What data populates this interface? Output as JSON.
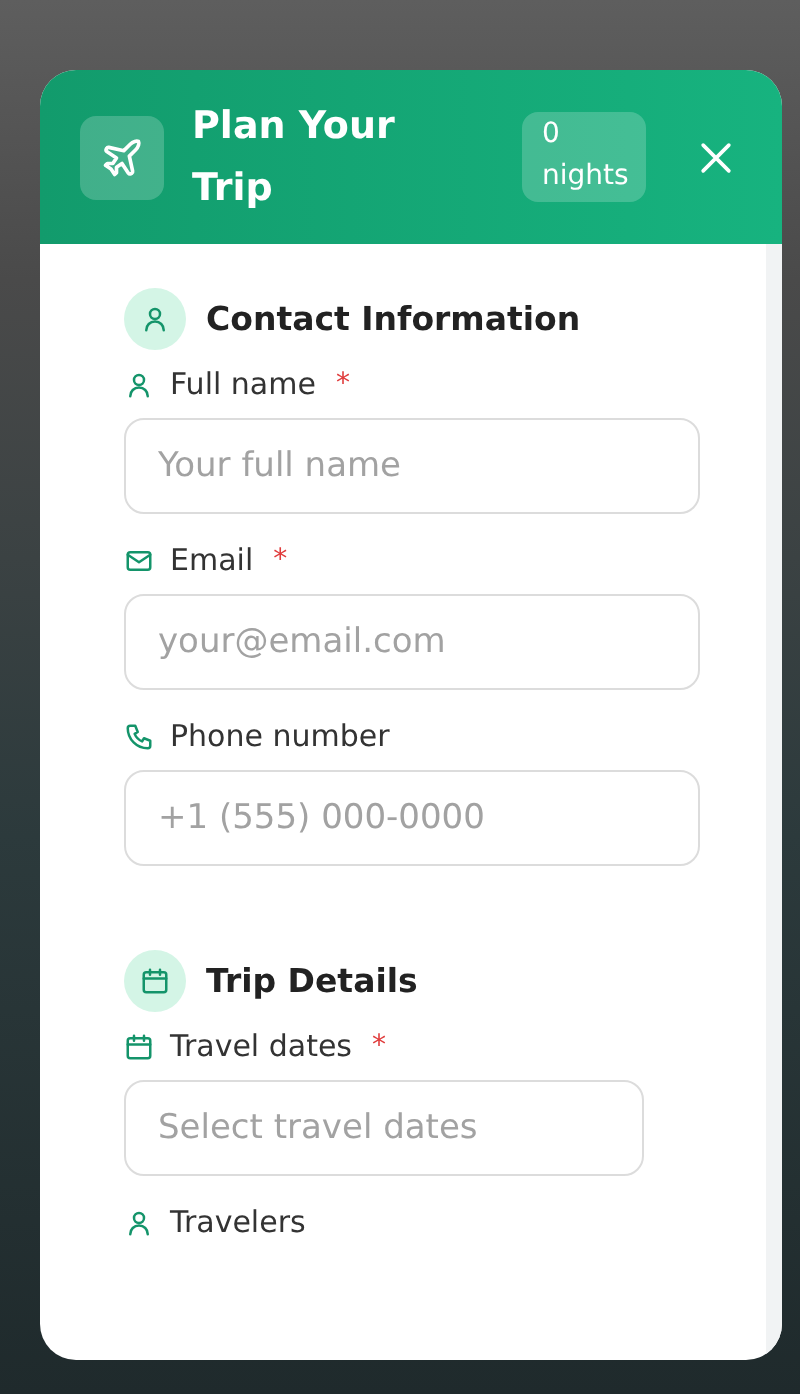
{
  "dialog": {
    "title": "Plan Your Trip",
    "badge": "0 nights"
  },
  "sections": [
    {
      "title": "Contact Information",
      "kind": "contact",
      "fields": [
        {
          "kind": "name",
          "label": "Full name",
          "required_mark": "*",
          "placeholder": "Your full name"
        },
        {
          "kind": "email",
          "label": "Email",
          "required_mark": "*",
          "placeholder": "your@email.com"
        },
        {
          "kind": "phone",
          "label": "Phone number",
          "placeholder": "+1 (555) 000-0000"
        }
      ]
    },
    {
      "title": "Trip Details",
      "kind": "trip",
      "fields": [
        {
          "kind": "dates",
          "label": "Travel dates",
          "required_mark": "*",
          "placeholder": "Select travel dates"
        },
        {
          "kind": "travelers",
          "label": "Travelers"
        }
      ]
    }
  ]
}
